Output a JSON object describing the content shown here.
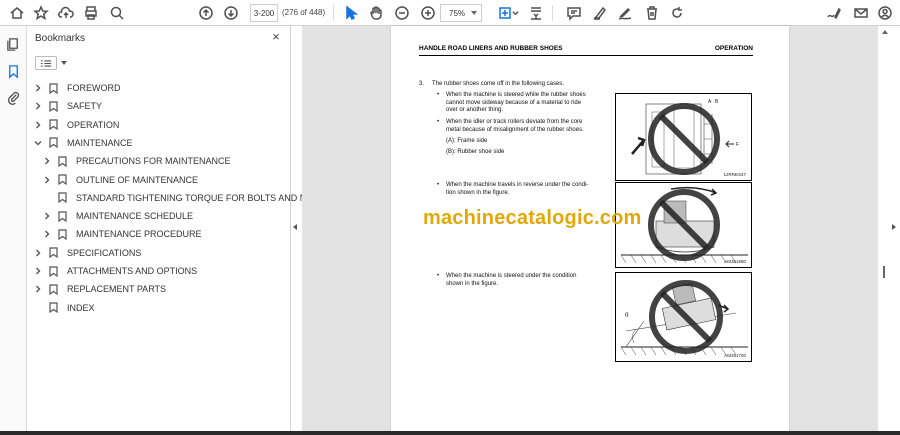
{
  "toolbar": {
    "page_input": "3-200",
    "page_count": "(276 of 448)",
    "zoom": "75%"
  },
  "bookmarks": {
    "title": "Bookmarks",
    "close": "×",
    "items": [
      {
        "label": "FOREWORD",
        "level": 0,
        "expandable": true,
        "expanded": false
      },
      {
        "label": "SAFETY",
        "level": 0,
        "expandable": true,
        "expanded": false
      },
      {
        "label": "OPERATION",
        "level": 0,
        "expandable": true,
        "expanded": false
      },
      {
        "label": "MAINTENANCE",
        "level": 0,
        "expandable": true,
        "expanded": true
      },
      {
        "label": "PRECAUTIONS FOR MAINTENANCE",
        "level": 1,
        "expandable": true,
        "expanded": false
      },
      {
        "label": "OUTLINE OF MAINTENANCE",
        "level": 1,
        "expandable": true,
        "expanded": false
      },
      {
        "label": "STANDARD TIGHTENING TORQUE FOR BOLTS AND NUTS",
        "level": 1,
        "expandable": false,
        "expanded": false
      },
      {
        "label": "MAINTENANCE SCHEDULE",
        "level": 1,
        "expandable": true,
        "expanded": false
      },
      {
        "label": "MAINTENANCE PROCEDURE",
        "level": 1,
        "expandable": true,
        "expanded": false
      },
      {
        "label": "SPECIFICATIONS",
        "level": 0,
        "expandable": true,
        "expanded": false
      },
      {
        "label": "ATTACHMENTS AND OPTIONS",
        "level": 0,
        "expandable": true,
        "expanded": false
      },
      {
        "label": "REPLACEMENT PARTS",
        "level": 0,
        "expandable": true,
        "expanded": false
      },
      {
        "label": "INDEX",
        "level": 0,
        "expandable": false,
        "expanded": false
      }
    ]
  },
  "document": {
    "header_left": "HANDLE ROAD LINERS AND RUBBER SHOES",
    "header_right": "OPERATION",
    "item_number": "3.",
    "item_text": "The rubber shoes come off in the following cases.",
    "case1_line1": "When the machine is steered while the rubber shoes",
    "case1_line2": "cannot move sideway because of a material to ride",
    "case1_line3": "over or another thing.",
    "case2_line1": "When the idler or track rollers deviate from the core",
    "case2_line2": "metal because of misalignment of the rubber shoes.",
    "legend_a": "(A): Frame side",
    "legend_b": "(B): Rubber shoe side",
    "case3_line1": "When the machine travels in reverse under the condi-",
    "case3_line2": "tion shown in the figure.",
    "case4_line1": "When the machine is steered under the condition",
    "case4_line2": "shown in the figure.",
    "fig1_code": "12RRES47",
    "fig2_code": "AM351680",
    "fig3_code": "AM351700",
    "fig1_labels": {
      "a": "A",
      "b": "B",
      "f": "F"
    },
    "fig3_angle": "θ"
  },
  "watermark": "machinecatalogic.com"
}
